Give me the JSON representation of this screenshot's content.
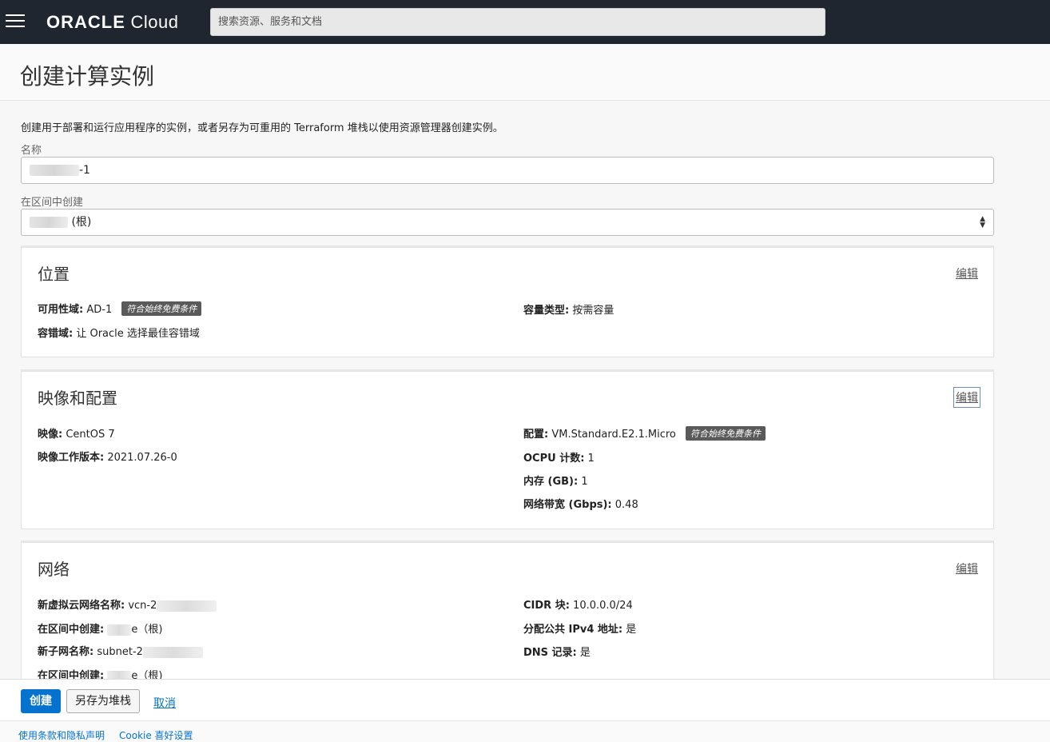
{
  "header": {
    "logo_oracle": "ORACLE",
    "logo_cloud": "Cloud",
    "search_placeholder": "搜索资源、服务和文档"
  },
  "page": {
    "title": "创建计算实例",
    "description": "创建用于部署和运行应用程序的实例，或者另存为可重用的 Terraform 堆栈以使用资源管理器创建实例。"
  },
  "form": {
    "name_label": "名称",
    "name_value_suffix": "-1",
    "compartment_label": "在区间中创建",
    "compartment_value_suffix": "(根)"
  },
  "placement": {
    "title": "位置",
    "edit": "编辑",
    "ad_key": "可用性域:",
    "ad_value": "AD-1",
    "ad_badge": "符合始终免费条件",
    "fd_key": "容错域:",
    "fd_value": "让 Oracle 选择最佳容错域",
    "capacity_key": "容量类型:",
    "capacity_value": "按需容量"
  },
  "image_shape": {
    "title": "映像和配置",
    "edit": "编辑",
    "image_key": "映像:",
    "image_value": "CentOS 7",
    "build_key": "映像工作版本:",
    "build_value": "2021.07.26-0",
    "shape_key": "配置:",
    "shape_value": "VM.Standard.E2.1.Micro",
    "shape_badge": "符合始终免费条件",
    "ocpu_key": "OCPU 计数:",
    "ocpu_value": "1",
    "mem_key": "内存 (GB):",
    "mem_value": "1",
    "bw_key": "网络带宽 (Gbps):",
    "bw_value": "0.48"
  },
  "networking": {
    "title": "网络",
    "edit": "编辑",
    "vcn_key": "新虚拟云网络名称:",
    "vcn_value": "vcn-2",
    "vcn_comp_key": "在区间中创建:",
    "vcn_comp_value": "e（根)",
    "subnet_key": "新子网名称:",
    "subnet_value": "subnet-2",
    "subnet_comp_key": "在区间中创建:",
    "subnet_comp_value": "e（根)",
    "cidr_key": "CIDR 块:",
    "cidr_value": "10.0.0.0/24",
    "ipv4_key": "分配公共 IPv4 地址:",
    "ipv4_value": "是",
    "dns_key": "DNS 记录:",
    "dns_value": "是"
  },
  "actions": {
    "create": "创建",
    "save_stack": "另存为堆栈",
    "cancel": "取消"
  },
  "footer": {
    "terms": "使用条款和隐私声明",
    "cookie": "Cookie 喜好设置"
  },
  "colors": {
    "topbar": "#1f2630",
    "primary": "#0572ce",
    "badge": "#5a5a5a"
  }
}
